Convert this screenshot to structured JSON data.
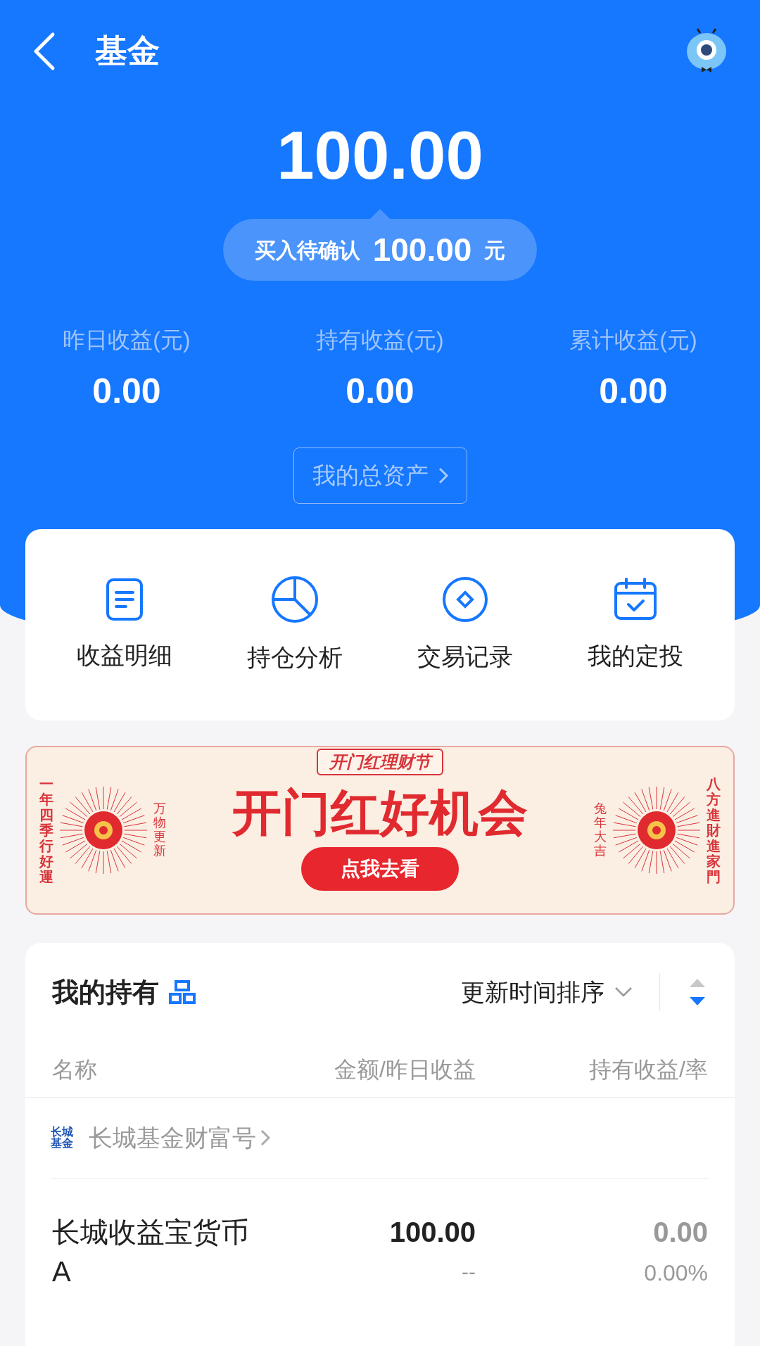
{
  "header": {
    "title": "基金"
  },
  "total": {
    "amount": "100.00",
    "pending_label": "买入待确认",
    "pending_amount": "100.00",
    "pending_unit": "元"
  },
  "stats": [
    {
      "label": "昨日收益(元)",
      "value": "0.00"
    },
    {
      "label": "持有收益(元)",
      "value": "0.00"
    },
    {
      "label": "累计收益(元)",
      "value": "0.00"
    }
  ],
  "assets_button": "我的总资产",
  "shortcuts": [
    {
      "kind": "document",
      "label": "收益明细"
    },
    {
      "kind": "pie",
      "label": "持仓分析"
    },
    {
      "kind": "coin",
      "label": "交易记录"
    },
    {
      "kind": "calendar",
      "label": "我的定投"
    }
  ],
  "banner": {
    "tag": "开门红理财节",
    "headline": "开门红好机会",
    "button": "点我去看",
    "left_arc": "一年四季行好運",
    "left_column": "万物更新",
    "right_column": "兔年大吉",
    "right_arc": "八方進財進家門"
  },
  "holdings": {
    "title": "我的持有",
    "sort": "更新时间排序",
    "columns": [
      "名称",
      "金额/昨日收益",
      "持有收益/率"
    ],
    "company": {
      "logo": "长城基金",
      "name": "长城基金财富号"
    },
    "rows": [
      {
        "name": "长城收益宝货币A",
        "amount": "100.00",
        "yesterday": "--",
        "profit": "0.00",
        "rate": "0.00%"
      }
    ]
  }
}
